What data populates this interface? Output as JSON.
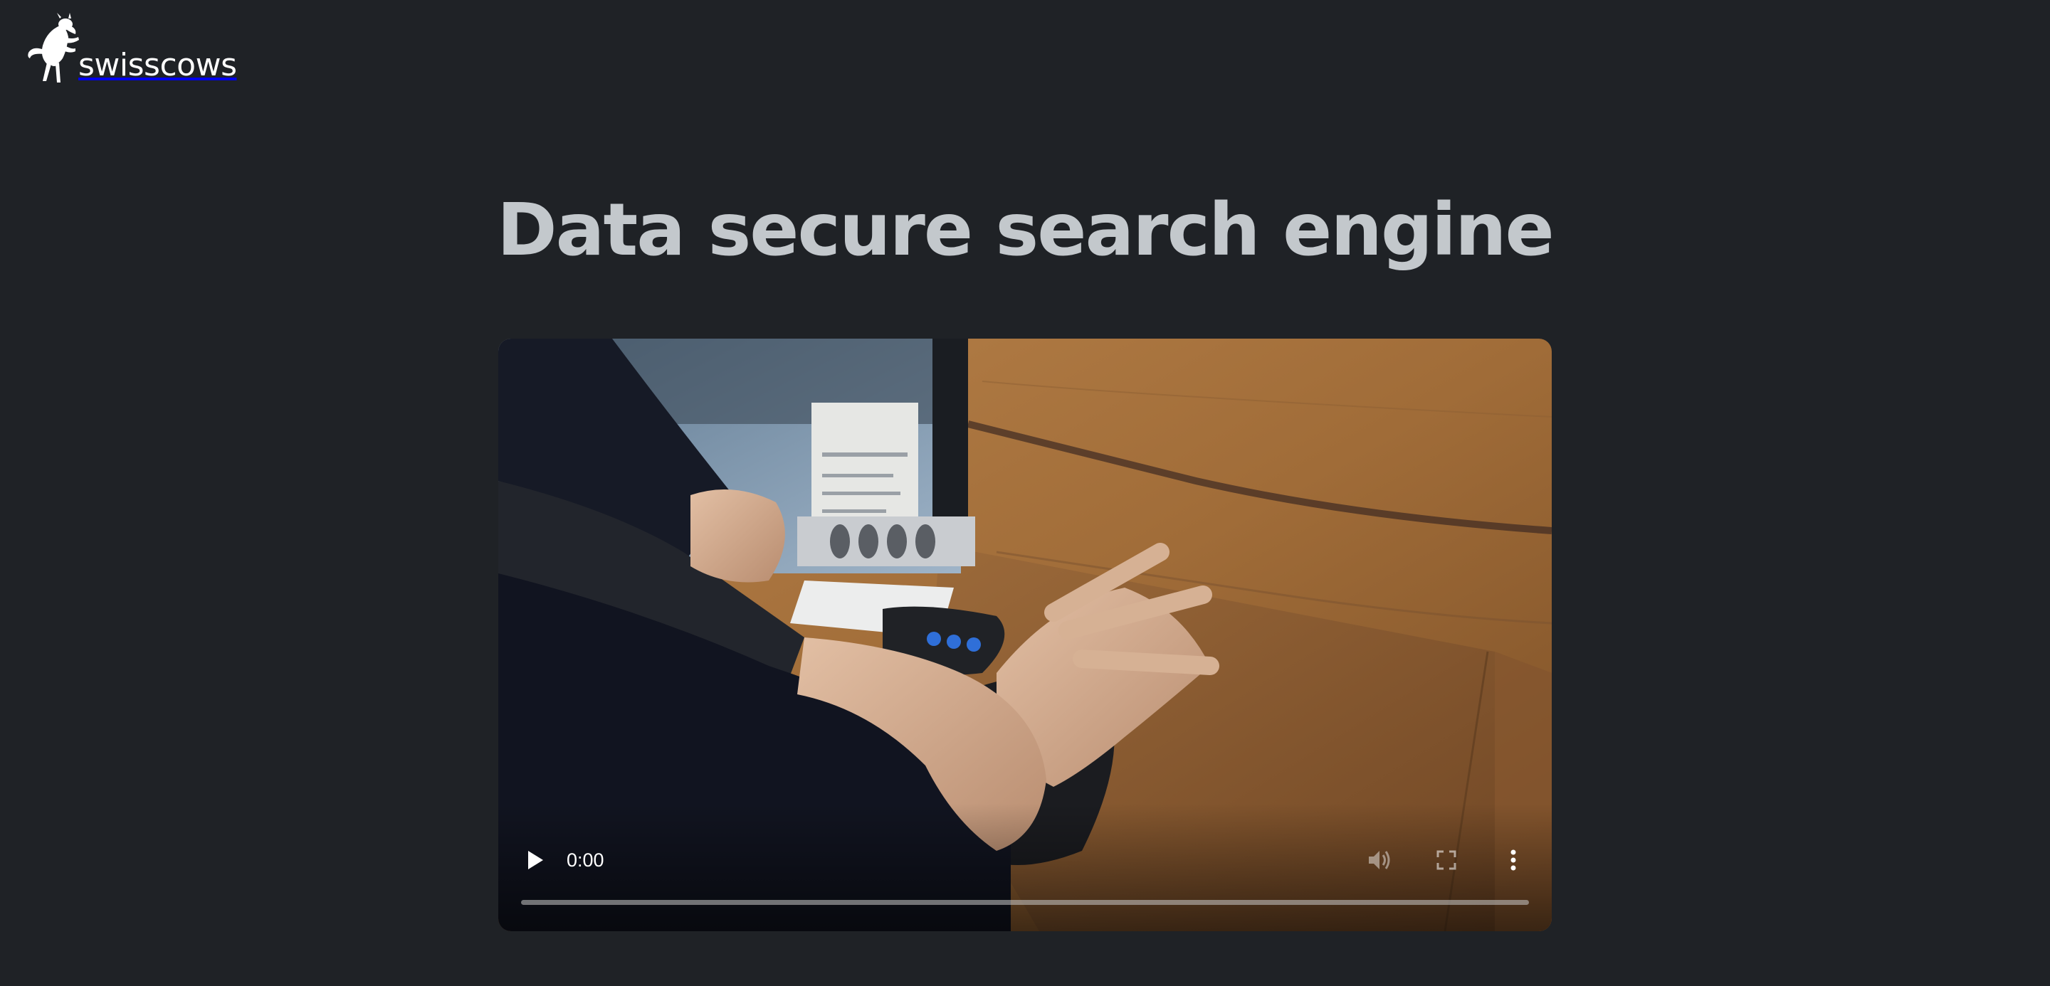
{
  "brand": {
    "name": "swisscows",
    "logo_icon": "cow-icon"
  },
  "page": {
    "title": "Data secure search engine"
  },
  "video": {
    "current_time": "0:00",
    "progress_fraction": 0,
    "controls": {
      "play_icon": "play-icon",
      "volume_icon": "volume-icon",
      "fullscreen_icon": "fullscreen-icon",
      "menu_icon": "more-vertical-icon"
    }
  },
  "colors": {
    "background": "#1f2226",
    "title": "#c3c8cc",
    "logo": "#ffffff",
    "control_icons": "#ffffff"
  }
}
